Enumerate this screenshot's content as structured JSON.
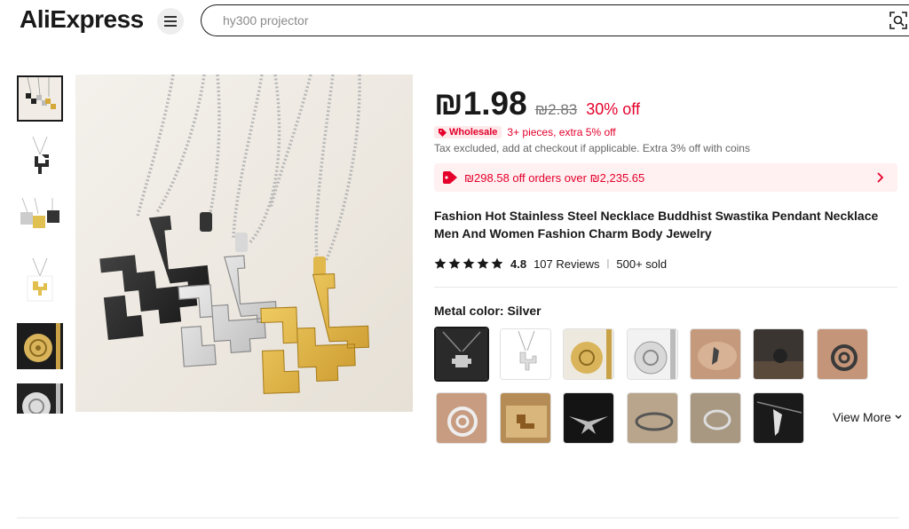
{
  "header": {
    "logo_text": "AliExpress",
    "menu_icon": "hamburger-menu-icon",
    "search_placeholder": "hy300 projector",
    "camera_icon": "image-search-icon"
  },
  "product": {
    "price": "₪1.98",
    "original_price": "₪2.83",
    "discount": "30% off",
    "wholesale_badge": "Wholesale",
    "wholesale_text": "3+ pieces, extra 5% off",
    "tax_note": "Tax excluded, add at checkout if applicable. Extra 3% off with coins",
    "coupon_text": "₪298.58 off orders over ₪2,235.65",
    "title": "Fashion Hot Stainless Steel Necklace Buddhist Swastika Pendant Necklace Men And Women Fashion Charm Body Jewelry",
    "rating": "4.8",
    "stars": 5,
    "reviews": "107 Reviews",
    "separator": "|",
    "sold": "500+ sold",
    "color_label": "Metal color: Silver",
    "view_more": "View More"
  },
  "colors": {
    "accent_red": "#e4002b",
    "brand_red": "#e62e04",
    "coupon_bg": "#fff0f1"
  }
}
